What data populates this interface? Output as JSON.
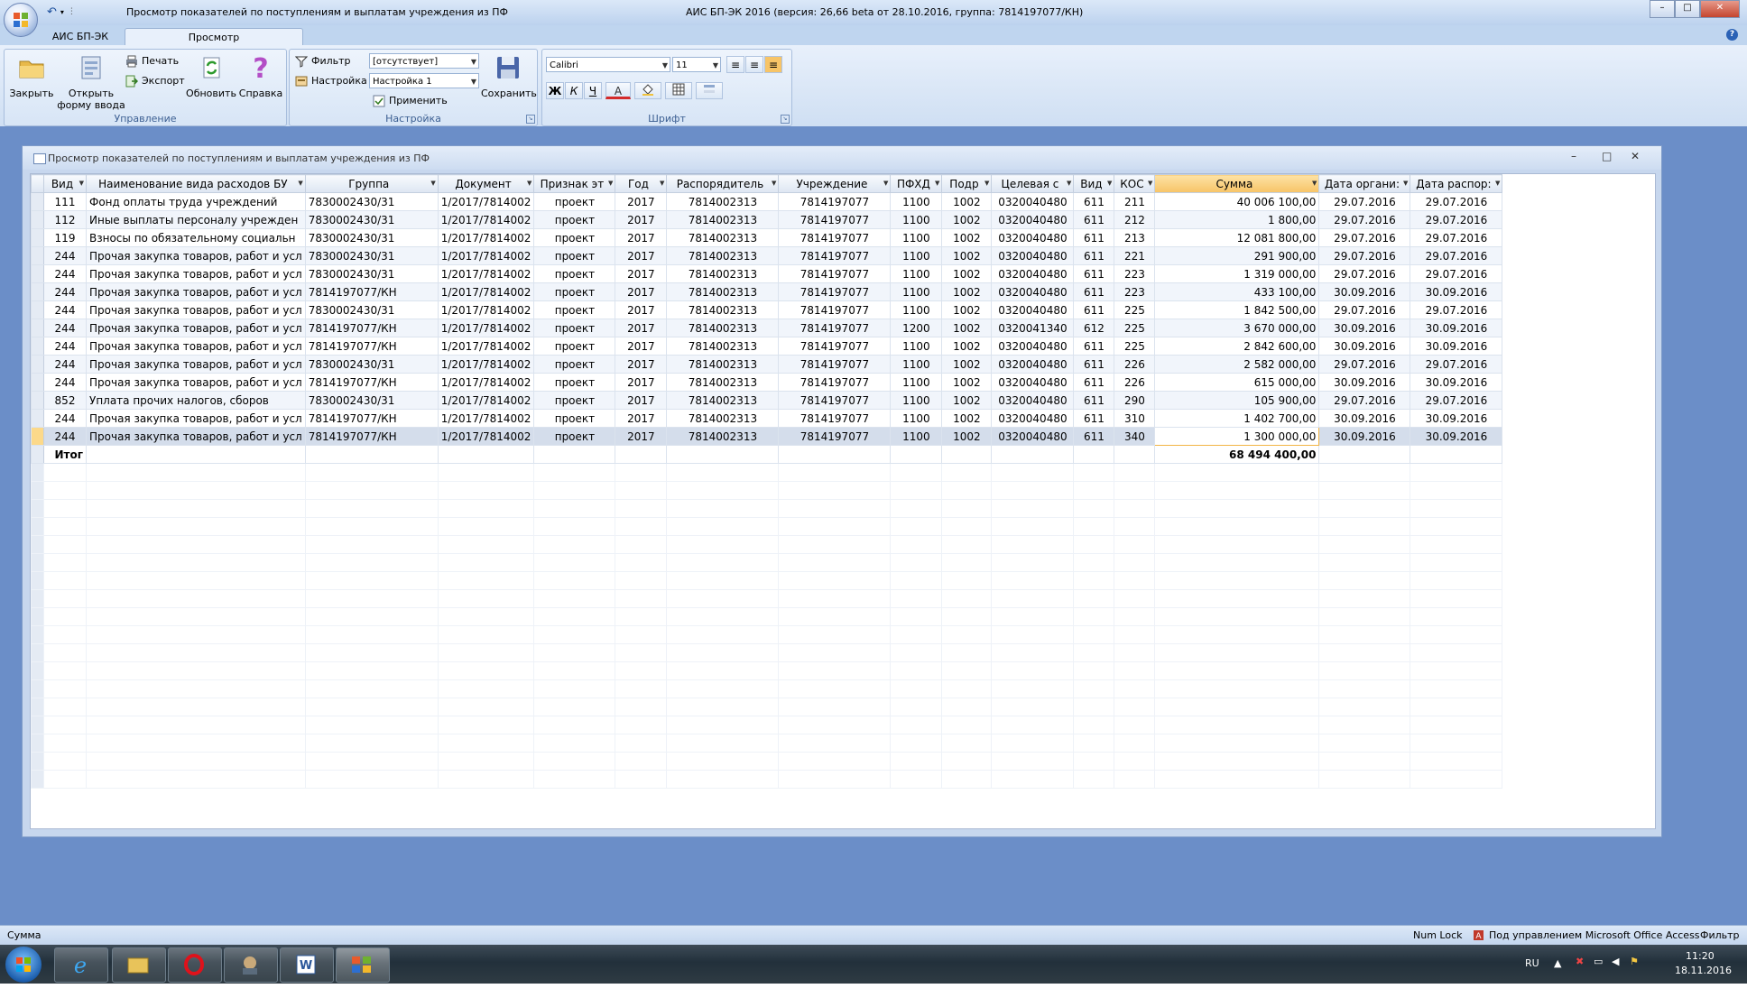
{
  "window": {
    "doc_caption": "Просмотр показателей по поступлениям и выплатам учреждения из ПФ",
    "app_title": "АИС БП-ЭК 2016 (версия: 26,66 beta от 28.10.2016, группа: 7814197077/КН)",
    "min_label": "–",
    "max_label": "□",
    "close_label": "✕"
  },
  "tabs": [
    {
      "label": "АИС БП-ЭК"
    },
    {
      "label": "Просмотр"
    }
  ],
  "ribbon": {
    "manage": {
      "label": "Управление",
      "close": "Закрыть",
      "open_form_1": "Открыть",
      "open_form_2": "форму ввода",
      "print": "Печать",
      "export": "Экспорт",
      "refresh": "Обновить",
      "help": "Справка"
    },
    "settings": {
      "label": "Настройка",
      "filter_label": "Фильтр",
      "filter_value": "[отсутствует]",
      "setup_label": "Настройка",
      "setup_value": "Настройка 1",
      "apply": "Применить",
      "save": "Сохранить"
    },
    "font": {
      "label": "Шрифт",
      "font_name": "Calibri",
      "font_size": "11",
      "bold": "Ж",
      "italic": "К",
      "underline": "Ч",
      "font_color_letter": "А"
    }
  },
  "doc": {
    "title": "Просмотр показателей по поступлениям и выплатам учреждения из ПФ"
  },
  "grid": {
    "columns": [
      "Вид",
      "Наименование вида расходов БУ",
      "Группа",
      "Документ",
      "Признак эт",
      "Год",
      "Распорядитель",
      "Учреждение",
      "ПФХД",
      "Подр",
      "Целевая с",
      "Вид",
      "КОС",
      "Сумма",
      "Дата органи:",
      "Дата распор:"
    ],
    "rows": [
      [
        "111",
        "Фонд оплаты труда учреждений",
        "7830002430/31",
        "1/2017/7814002",
        "проект",
        "2017",
        "7814002313",
        "7814197077",
        "1100",
        "1002",
        "0320040480",
        "611",
        "211",
        "40 006 100,00",
        "29.07.2016",
        "29.07.2016"
      ],
      [
        "112",
        "Иные выплаты персоналу учрежден",
        "7830002430/31",
        "1/2017/7814002",
        "проект",
        "2017",
        "7814002313",
        "7814197077",
        "1100",
        "1002",
        "0320040480",
        "611",
        "212",
        "1 800,00",
        "29.07.2016",
        "29.07.2016"
      ],
      [
        "119",
        "Взносы по обязательному социальн",
        "7830002430/31",
        "1/2017/7814002",
        "проект",
        "2017",
        "7814002313",
        "7814197077",
        "1100",
        "1002",
        "0320040480",
        "611",
        "213",
        "12 081 800,00",
        "29.07.2016",
        "29.07.2016"
      ],
      [
        "244",
        "Прочая закупка товаров, работ и усл",
        "7830002430/31",
        "1/2017/7814002",
        "проект",
        "2017",
        "7814002313",
        "7814197077",
        "1100",
        "1002",
        "0320040480",
        "611",
        "221",
        "291 900,00",
        "29.07.2016",
        "29.07.2016"
      ],
      [
        "244",
        "Прочая закупка товаров, работ и усл",
        "7830002430/31",
        "1/2017/7814002",
        "проект",
        "2017",
        "7814002313",
        "7814197077",
        "1100",
        "1002",
        "0320040480",
        "611",
        "223",
        "1 319 000,00",
        "29.07.2016",
        "29.07.2016"
      ],
      [
        "244",
        "Прочая закупка товаров, работ и усл",
        "7814197077/КН",
        "1/2017/7814002",
        "проект",
        "2017",
        "7814002313",
        "7814197077",
        "1100",
        "1002",
        "0320040480",
        "611",
        "223",
        "433 100,00",
        "30.09.2016",
        "30.09.2016"
      ],
      [
        "244",
        "Прочая закупка товаров, работ и усл",
        "7830002430/31",
        "1/2017/7814002",
        "проект",
        "2017",
        "7814002313",
        "7814197077",
        "1100",
        "1002",
        "0320040480",
        "611",
        "225",
        "1 842 500,00",
        "29.07.2016",
        "29.07.2016"
      ],
      [
        "244",
        "Прочая закупка товаров, работ и усл",
        "7814197077/КН",
        "1/2017/7814002",
        "проект",
        "2017",
        "7814002313",
        "7814197077",
        "1200",
        "1002",
        "0320041340",
        "612",
        "225",
        "3 670 000,00",
        "30.09.2016",
        "30.09.2016"
      ],
      [
        "244",
        "Прочая закупка товаров, работ и усл",
        "7814197077/КН",
        "1/2017/7814002",
        "проект",
        "2017",
        "7814002313",
        "7814197077",
        "1100",
        "1002",
        "0320040480",
        "611",
        "225",
        "2 842 600,00",
        "30.09.2016",
        "30.09.2016"
      ],
      [
        "244",
        "Прочая закупка товаров, работ и усл",
        "7830002430/31",
        "1/2017/7814002",
        "проект",
        "2017",
        "7814002313",
        "7814197077",
        "1100",
        "1002",
        "0320040480",
        "611",
        "226",
        "2 582 000,00",
        "29.07.2016",
        "29.07.2016"
      ],
      [
        "244",
        "Прочая закупка товаров, работ и усл",
        "7814197077/КН",
        "1/2017/7814002",
        "проект",
        "2017",
        "7814002313",
        "7814197077",
        "1100",
        "1002",
        "0320040480",
        "611",
        "226",
        "615 000,00",
        "30.09.2016",
        "30.09.2016"
      ],
      [
        "852",
        "Уплата прочих налогов, сборов",
        "7830002430/31",
        "1/2017/7814002",
        "проект",
        "2017",
        "7814002313",
        "7814197077",
        "1100",
        "1002",
        "0320040480",
        "611",
        "290",
        "105 900,00",
        "29.07.2016",
        "29.07.2016"
      ],
      [
        "244",
        "Прочая закупка товаров, работ и усл",
        "7814197077/КН",
        "1/2017/7814002",
        "проект",
        "2017",
        "7814002313",
        "7814197077",
        "1100",
        "1002",
        "0320040480",
        "611",
        "310",
        "1 402 700,00",
        "30.09.2016",
        "30.09.2016"
      ],
      [
        "244",
        "Прочая закупка товаров, работ и усл",
        "7814197077/КН",
        "1/2017/7814002",
        "проект",
        "2017",
        "7814002313",
        "7814197077",
        "1100",
        "1002",
        "0320040480",
        "611",
        "340",
        "1 300 000,00",
        "30.09.2016",
        "30.09.2016"
      ]
    ],
    "current_row": 13,
    "total_label": "Итог",
    "total_sum": "68 494 400,00"
  },
  "status": {
    "field": "Сумма",
    "numlock": "Num Lock",
    "managed": "Под управлением Microsoft Office Access",
    "filter": "Фильтр"
  },
  "taskbar": {
    "lang": "RU",
    "time": "11:20",
    "date": "18.11.2016"
  },
  "colors": {
    "workspace": "#6b8ec8",
    "selected_header": "#f7c467",
    "ribbon_bg": "#dbe7f6"
  }
}
